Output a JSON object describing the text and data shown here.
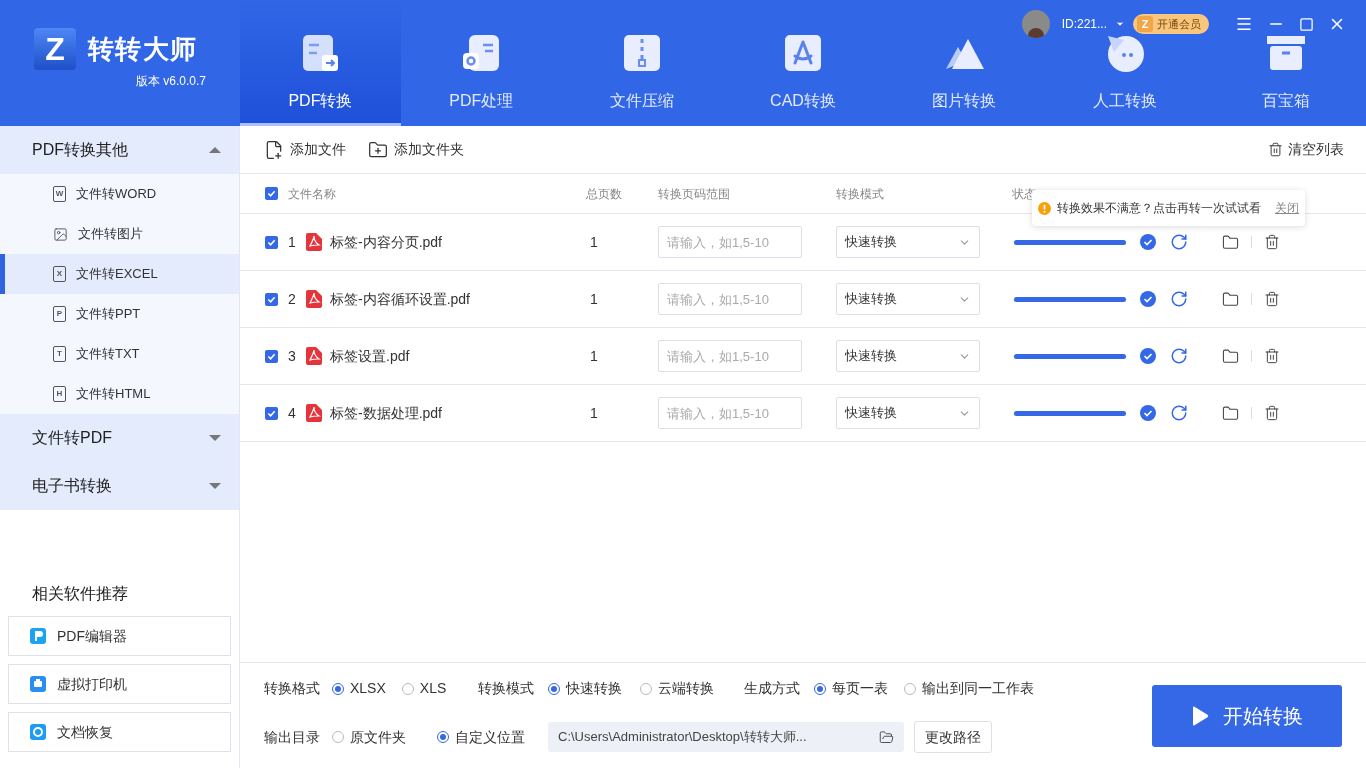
{
  "app": {
    "logo_mark": "Z",
    "name": "转转大师",
    "version": "版本 v6.0.0.7"
  },
  "account": {
    "id": "ID:221...",
    "vip_mark": "Z",
    "vip_label": "开通会员"
  },
  "nav_tabs": [
    {
      "label": "PDF转换",
      "kind": "convert",
      "selected": true
    },
    {
      "label": "PDF处理",
      "kind": "process",
      "selected": false
    },
    {
      "label": "文件压缩",
      "kind": "zip",
      "selected": false
    },
    {
      "label": "CAD转换",
      "kind": "cad",
      "selected": false
    },
    {
      "label": "图片转换",
      "kind": "image",
      "selected": false
    },
    {
      "label": "人工转换",
      "kind": "chat",
      "selected": false
    },
    {
      "label": "百宝箱",
      "kind": "box",
      "selected": false
    }
  ],
  "sidebar": {
    "groups": [
      {
        "label": "PDF转换其他",
        "expanded": true,
        "items": [
          {
            "label": "文件转WORD",
            "glyph": "W",
            "kind": "doc",
            "selected": false
          },
          {
            "label": "文件转图片",
            "kind": "image",
            "selected": false
          },
          {
            "label": "文件转EXCEL",
            "glyph": "X",
            "kind": "doc",
            "selected": true
          },
          {
            "label": "文件转PPT",
            "glyph": "P",
            "kind": "doc",
            "selected": false
          },
          {
            "label": "文件转TXT",
            "glyph": "T",
            "kind": "doc",
            "selected": false
          },
          {
            "label": "文件转HTML",
            "glyph": "H",
            "kind": "doc",
            "selected": false
          }
        ]
      },
      {
        "label": "文件转PDF",
        "expanded": false
      },
      {
        "label": "电子书转换",
        "expanded": false
      }
    ],
    "related_title": "相关软件推荐",
    "related": [
      {
        "label": "PDF编辑器",
        "kind": "pdf"
      },
      {
        "label": "虚拟打印机",
        "kind": "printer"
      },
      {
        "label": "文档恢复",
        "kind": "recover"
      }
    ]
  },
  "toolbar": {
    "add_file": "添加文件",
    "add_folder": "添加文件夹",
    "clear": "清空列表"
  },
  "table": {
    "all_checked": true,
    "columns": [
      "文件名称",
      "总页数",
      "转换页码范围",
      "转换模式",
      "状态"
    ],
    "rows": [
      {
        "checked": true,
        "index": "1",
        "name": "标签-内容分页.pdf",
        "pages": "1",
        "range_placeholder": "请输入，如1,5-10",
        "mode": "快速转换",
        "level": 1,
        "done": true
      },
      {
        "checked": true,
        "index": "2",
        "name": "标签-内容循环设置.pdf",
        "pages": "1",
        "range_placeholder": "请输入，如1,5-10",
        "mode": "快速转换",
        "level": 1,
        "done": true
      },
      {
        "checked": true,
        "index": "3",
        "name": "标签设置.pdf",
        "pages": "1",
        "range_placeholder": "请输入，如1,5-10",
        "mode": "快速转换",
        "level": 1,
        "done": true
      },
      {
        "checked": true,
        "index": "4",
        "name": "标签-数据处理.pdf",
        "pages": "1",
        "range_placeholder": "请输入，如1,5-10",
        "mode": "快速转换",
        "level": 1,
        "done": true
      }
    ]
  },
  "tooltip": {
    "text": "转换效果不满意？点击再转一次试试看",
    "close": "关闭"
  },
  "options": {
    "format": {
      "label": "转换格式",
      "choices": [
        {
          "label": "XLSX",
          "selected": true
        },
        {
          "label": "XLS",
          "selected": false
        }
      ]
    },
    "mode": {
      "label": "转换模式",
      "choices": [
        {
          "label": "快速转换",
          "selected": true
        },
        {
          "label": "云端转换",
          "selected": false
        }
      ]
    },
    "generate": {
      "label": "生成方式",
      "choices": [
        {
          "label": "每页一表",
          "selected": true
        },
        {
          "label": "输出到同一工作表",
          "selected": false
        }
      ]
    },
    "output": {
      "label": "输出目录",
      "choices": [
        {
          "label": "原文件夹",
          "selected": false
        },
        {
          "label": "自定义位置",
          "selected": true
        }
      ],
      "path": "C:\\Users\\Administrator\\Desktop\\转转大师...",
      "change": "更改路径"
    }
  },
  "start_button": "开始转换"
}
